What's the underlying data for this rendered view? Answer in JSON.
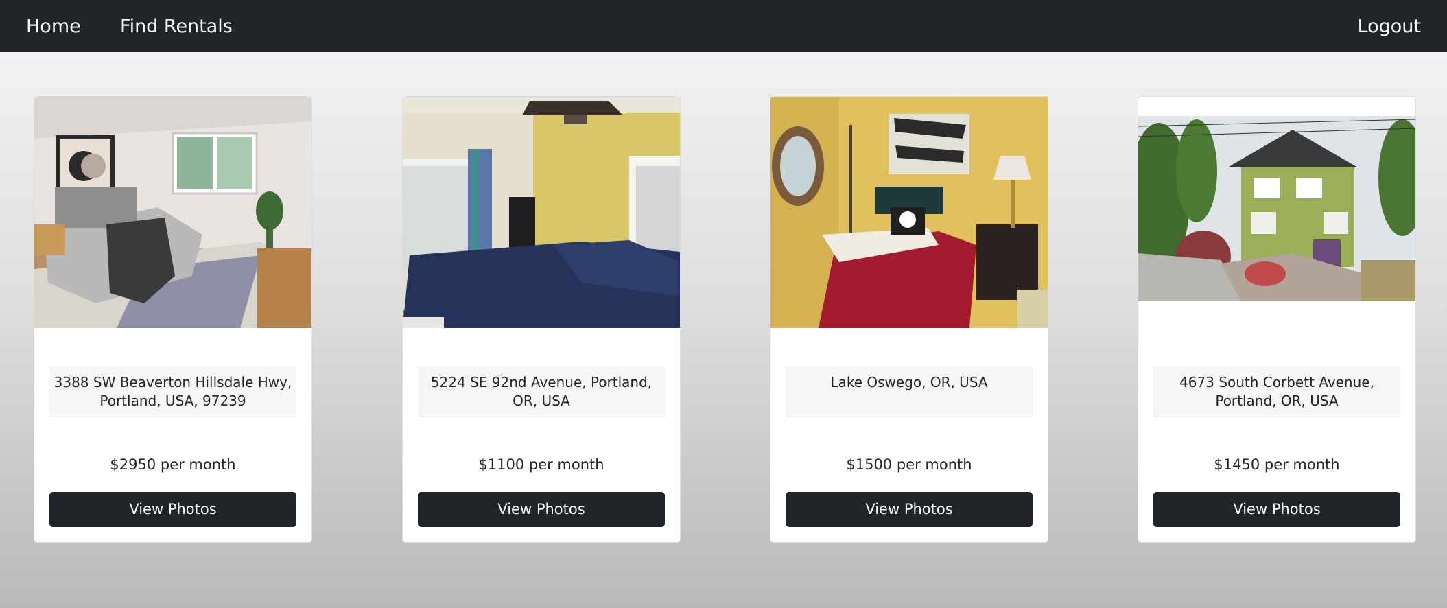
{
  "nav": {
    "home": "Home",
    "find_rentals": "Find Rentals",
    "logout": "Logout"
  },
  "listings": [
    {
      "address": "3388 SW Beaverton Hillsdale Hwy, Portland, USA, 97239",
      "price": "$2950 per month",
      "button": "View Photos"
    },
    {
      "address": "5224 SE 92nd Avenue, Portland, OR, USA",
      "price": "$1100 per month",
      "button": "View Photos"
    },
    {
      "address": "Lake Oswego, OR, USA",
      "price": "$1500 per month",
      "button": "View Photos"
    },
    {
      "address": "4673 South Corbett Avenue, Portland, OR, USA",
      "price": "$1450 per month",
      "button": "View Photos"
    }
  ],
  "colors": {
    "navbar": "#212529",
    "button": "#212529",
    "address_bg": "#f6f6f6"
  }
}
